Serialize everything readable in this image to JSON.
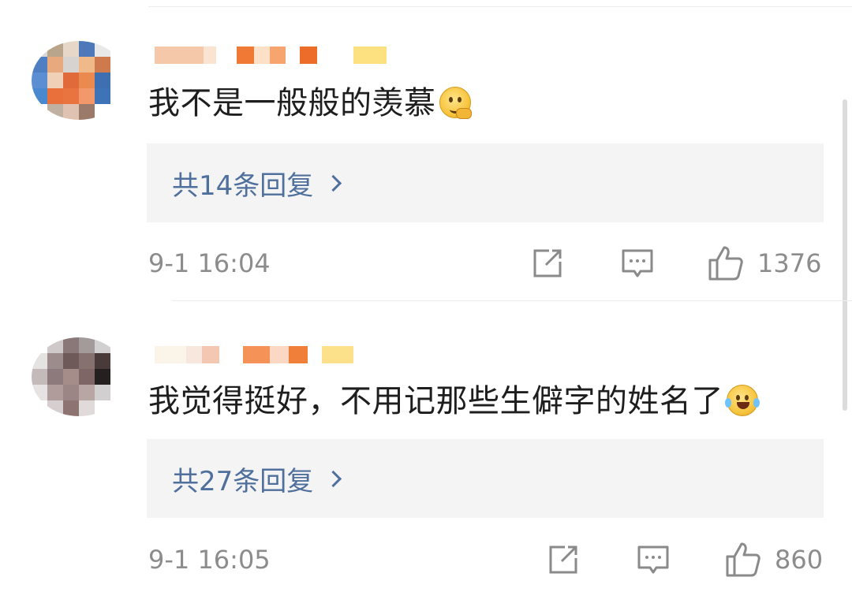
{
  "comments": [
    {
      "text": "我不是一般般的羡慕",
      "emoji": "thinking-face-emoji",
      "replies_label": "共14条回复",
      "timestamp": "9-1 16:04",
      "likes": "1376"
    },
    {
      "text": "我觉得挺好，不用记那些生僻字的姓名了",
      "emoji": "laughing-crying-emoji",
      "replies_label": "共27条回复",
      "timestamp": "9-1 16:05",
      "likes": "860"
    }
  ],
  "colors": {
    "reply_link": "#4f6f9c",
    "meta_text": "#8c8c8c",
    "reply_box_bg": "#f4f4f4",
    "comment_text": "#1e1e1e"
  },
  "icons": {
    "share": "share-icon",
    "comment": "comment-icon",
    "like": "thumbs-up-icon"
  }
}
